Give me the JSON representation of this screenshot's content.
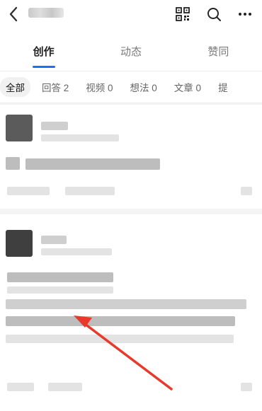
{
  "header": {
    "back_icon": "back-arrow-icon",
    "icons": [
      "qr-code-icon",
      "search-icon",
      "more-icon"
    ]
  },
  "tabs": [
    {
      "label": "创作",
      "active": true
    },
    {
      "label": "动态",
      "active": false
    },
    {
      "label": "赞同",
      "active": false
    }
  ],
  "filters": [
    {
      "label": "全部",
      "active": true
    },
    {
      "label": "回答 2",
      "active": false
    },
    {
      "label": "视频 0",
      "active": false
    },
    {
      "label": "想法 0",
      "active": false
    },
    {
      "label": "文章 0",
      "active": false
    },
    {
      "label": "提",
      "active": false
    }
  ],
  "colors": {
    "accent": "#1772f6",
    "arrow": "#e8392b",
    "background": "#f4f4f4"
  }
}
